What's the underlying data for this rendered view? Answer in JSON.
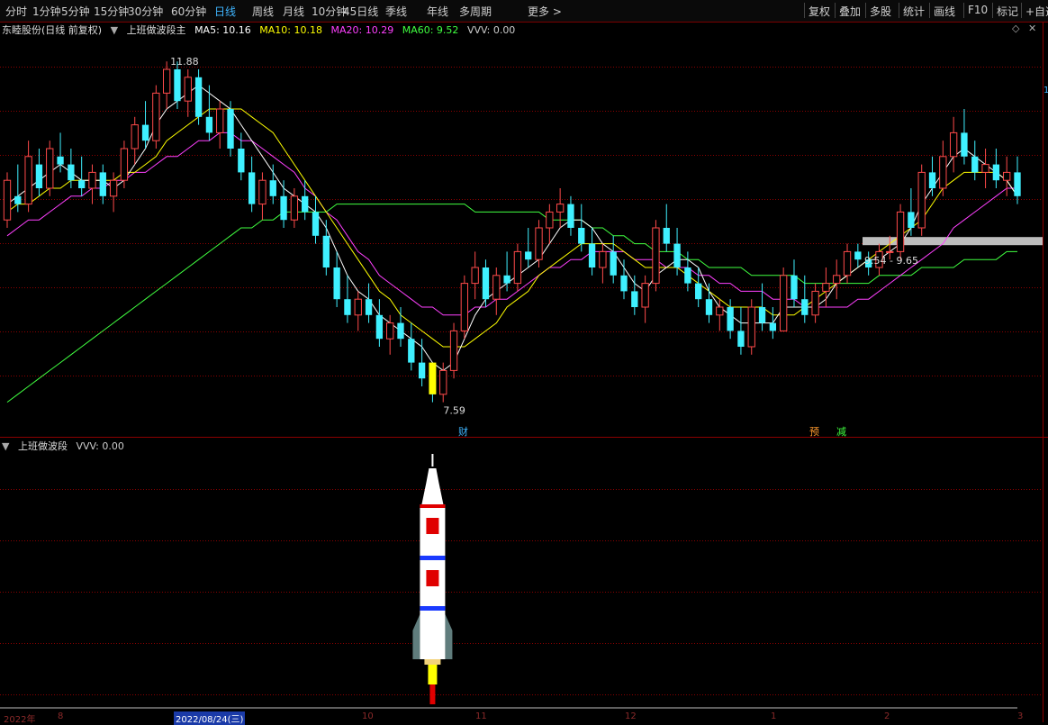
{
  "toolbar": {
    "periods": [
      "分时",
      "1分钟",
      "5分钟",
      "15分钟",
      "30分钟",
      "60分钟",
      "日线",
      "周线",
      "月线",
      "10分钟",
      "45日线",
      "季线",
      "年线",
      "多周期",
      "更多 >"
    ],
    "active_period": "日线",
    "tools": [
      "复权",
      "叠加",
      "多股",
      "统计",
      "画线",
      "F10",
      "标记",
      "+自选"
    ]
  },
  "main_legend": {
    "stock": "东睦股份(日线 前复权)",
    "indicator": "上班做波段主",
    "ma5": "MA5: 10.16",
    "ma10": "MA10: 10.18",
    "ma20": "MA20: 10.29",
    "ma60": "MA60: 9.52",
    "vvv": "VVV: 0.00"
  },
  "sub_legend": {
    "indicator": "上班做波段",
    "vvv": "VVV: 0.00"
  },
  "colors": {
    "up": "#ff4a4a",
    "down": "#3ff0ff",
    "ma5": "#ffffff",
    "ma10": "#ffff00",
    "ma20": "#ff40ff",
    "ma60": "#40ff40",
    "grid": "#8b0000"
  },
  "annotations": {
    "high_label": "11.88",
    "low_label": "7.59",
    "range_label": "9.54 - 9.65",
    "right_edge_label": "1",
    "marker_cai": "财",
    "marker_yu": "预",
    "marker_jian": "减"
  },
  "date_axis": {
    "labels": [
      "2022年",
      "8",
      "2022/08/24(三)",
      "10",
      "11",
      "12",
      "1",
      "2",
      "3"
    ],
    "highlighted": "2022/08/24(三)"
  },
  "chart_data": {
    "type": "candlestick",
    "title": "东睦股份(日线 前复权)",
    "ylim": [
      7.3,
      12.3
    ],
    "candles": [
      {
        "o": 9.9,
        "h": 10.5,
        "l": 9.8,
        "c": 10.4
      },
      {
        "o": 10.2,
        "h": 10.6,
        "l": 10.0,
        "c": 10.1
      },
      {
        "o": 10.1,
        "h": 10.9,
        "l": 10.0,
        "c": 10.7
      },
      {
        "o": 10.6,
        "h": 10.8,
        "l": 10.2,
        "c": 10.3
      },
      {
        "o": 10.3,
        "h": 10.9,
        "l": 10.2,
        "c": 10.8
      },
      {
        "o": 10.7,
        "h": 11.0,
        "l": 10.5,
        "c": 10.6
      },
      {
        "o": 10.6,
        "h": 10.8,
        "l": 10.3,
        "c": 10.4
      },
      {
        "o": 10.4,
        "h": 10.7,
        "l": 10.2,
        "c": 10.3
      },
      {
        "o": 10.3,
        "h": 10.6,
        "l": 10.1,
        "c": 10.5
      },
      {
        "o": 10.5,
        "h": 10.6,
        "l": 10.1,
        "c": 10.2
      },
      {
        "o": 10.2,
        "h": 10.5,
        "l": 10.0,
        "c": 10.4
      },
      {
        "o": 10.4,
        "h": 10.9,
        "l": 10.3,
        "c": 10.8
      },
      {
        "o": 10.8,
        "h": 11.2,
        "l": 10.6,
        "c": 11.1
      },
      {
        "o": 11.1,
        "h": 11.4,
        "l": 10.8,
        "c": 10.9
      },
      {
        "o": 10.9,
        "h": 11.6,
        "l": 10.8,
        "c": 11.5
      },
      {
        "o": 11.5,
        "h": 11.9,
        "l": 11.3,
        "c": 11.8
      },
      {
        "o": 11.8,
        "h": 11.9,
        "l": 11.3,
        "c": 11.4
      },
      {
        "o": 11.4,
        "h": 11.8,
        "l": 11.2,
        "c": 11.7
      },
      {
        "o": 11.7,
        "h": 11.8,
        "l": 11.1,
        "c": 11.2
      },
      {
        "o": 11.2,
        "h": 11.6,
        "l": 10.9,
        "c": 11.0
      },
      {
        "o": 11.0,
        "h": 11.4,
        "l": 10.8,
        "c": 11.3
      },
      {
        "o": 11.3,
        "h": 11.4,
        "l": 10.7,
        "c": 10.8
      },
      {
        "o": 10.8,
        "h": 11.0,
        "l": 10.4,
        "c": 10.5
      },
      {
        "o": 10.5,
        "h": 10.7,
        "l": 10.0,
        "c": 10.1
      },
      {
        "o": 10.1,
        "h": 10.5,
        "l": 9.9,
        "c": 10.4
      },
      {
        "o": 10.4,
        "h": 10.6,
        "l": 10.1,
        "c": 10.2
      },
      {
        "o": 10.2,
        "h": 10.4,
        "l": 9.8,
        "c": 9.9
      },
      {
        "o": 9.9,
        "h": 10.3,
        "l": 9.8,
        "c": 10.2
      },
      {
        "o": 10.2,
        "h": 10.4,
        "l": 9.9,
        "c": 10.0
      },
      {
        "o": 10.0,
        "h": 10.2,
        "l": 9.6,
        "c": 9.7
      },
      {
        "o": 9.7,
        "h": 9.9,
        "l": 9.2,
        "c": 9.3
      },
      {
        "o": 9.3,
        "h": 9.5,
        "l": 8.8,
        "c": 8.9
      },
      {
        "o": 8.9,
        "h": 9.2,
        "l": 8.6,
        "c": 8.7
      },
      {
        "o": 8.7,
        "h": 9.0,
        "l": 8.5,
        "c": 8.9
      },
      {
        "o": 8.9,
        "h": 9.1,
        "l": 8.6,
        "c": 8.7
      },
      {
        "o": 8.7,
        "h": 8.9,
        "l": 8.3,
        "c": 8.4
      },
      {
        "o": 8.4,
        "h": 8.7,
        "l": 8.2,
        "c": 8.6
      },
      {
        "o": 8.6,
        "h": 8.8,
        "l": 8.3,
        "c": 8.4
      },
      {
        "o": 8.4,
        "h": 8.6,
        "l": 8.0,
        "c": 8.1
      },
      {
        "o": 8.1,
        "h": 8.4,
        "l": 7.8,
        "c": 7.9
      },
      {
        "o": 7.9,
        "h": 8.1,
        "l": 7.6,
        "c": 7.7
      },
      {
        "o": 7.7,
        "h": 8.1,
        "l": 7.6,
        "c": 8.0
      },
      {
        "o": 8.0,
        "h": 8.6,
        "l": 7.9,
        "c": 8.5
      },
      {
        "o": 8.5,
        "h": 9.2,
        "l": 8.4,
        "c": 9.1
      },
      {
        "o": 9.1,
        "h": 9.5,
        "l": 8.9,
        "c": 9.3
      },
      {
        "o": 9.3,
        "h": 9.4,
        "l": 8.8,
        "c": 8.9
      },
      {
        "o": 8.9,
        "h": 9.3,
        "l": 8.7,
        "c": 9.2
      },
      {
        "o": 9.2,
        "h": 9.5,
        "l": 9.0,
        "c": 9.1
      },
      {
        "o": 9.1,
        "h": 9.6,
        "l": 9.0,
        "c": 9.5
      },
      {
        "o": 9.5,
        "h": 9.8,
        "l": 9.3,
        "c": 9.4
      },
      {
        "o": 9.4,
        "h": 9.9,
        "l": 9.3,
        "c": 9.8
      },
      {
        "o": 9.8,
        "h": 10.1,
        "l": 9.6,
        "c": 10.0
      },
      {
        "o": 10.0,
        "h": 10.3,
        "l": 9.8,
        "c": 10.1
      },
      {
        "o": 10.1,
        "h": 10.2,
        "l": 9.7,
        "c": 9.8
      },
      {
        "o": 9.8,
        "h": 10.1,
        "l": 9.5,
        "c": 9.6
      },
      {
        "o": 9.6,
        "h": 9.8,
        "l": 9.2,
        "c": 9.3
      },
      {
        "o": 9.3,
        "h": 9.6,
        "l": 9.1,
        "c": 9.5
      },
      {
        "o": 9.5,
        "h": 9.7,
        "l": 9.1,
        "c": 9.2
      },
      {
        "o": 9.2,
        "h": 9.4,
        "l": 8.9,
        "c": 9.0
      },
      {
        "o": 9.0,
        "h": 9.2,
        "l": 8.7,
        "c": 8.8
      },
      {
        "o": 8.8,
        "h": 9.2,
        "l": 8.6,
        "c": 9.1
      },
      {
        "o": 9.1,
        "h": 9.9,
        "l": 9.0,
        "c": 9.8
      },
      {
        "o": 9.8,
        "h": 10.1,
        "l": 9.5,
        "c": 9.6
      },
      {
        "o": 9.6,
        "h": 9.8,
        "l": 9.2,
        "c": 9.3
      },
      {
        "o": 9.3,
        "h": 9.5,
        "l": 9.0,
        "c": 9.1
      },
      {
        "o": 9.1,
        "h": 9.3,
        "l": 8.8,
        "c": 8.9
      },
      {
        "o": 8.9,
        "h": 9.1,
        "l": 8.6,
        "c": 8.7
      },
      {
        "o": 8.7,
        "h": 8.9,
        "l": 8.5,
        "c": 8.8
      },
      {
        "o": 8.8,
        "h": 8.9,
        "l": 8.4,
        "c": 8.5
      },
      {
        "o": 8.5,
        "h": 8.8,
        "l": 8.2,
        "c": 8.3
      },
      {
        "o": 8.3,
        "h": 8.9,
        "l": 8.2,
        "c": 8.8
      },
      {
        "o": 8.8,
        "h": 9.1,
        "l": 8.5,
        "c": 8.6
      },
      {
        "o": 8.6,
        "h": 8.8,
        "l": 8.4,
        "c": 8.5
      },
      {
        "o": 8.5,
        "h": 9.3,
        "l": 8.5,
        "c": 9.2
      },
      {
        "o": 9.2,
        "h": 9.4,
        "l": 8.8,
        "c": 8.9
      },
      {
        "o": 8.9,
        "h": 9.2,
        "l": 8.6,
        "c": 8.7
      },
      {
        "o": 8.7,
        "h": 9.1,
        "l": 8.6,
        "c": 9.0
      },
      {
        "o": 9.0,
        "h": 9.3,
        "l": 8.8,
        "c": 9.1
      },
      {
        "o": 9.1,
        "h": 9.4,
        "l": 8.9,
        "c": 9.2
      },
      {
        "o": 9.2,
        "h": 9.6,
        "l": 9.1,
        "c": 9.5
      },
      {
        "o": 9.5,
        "h": 9.6,
        "l": 9.3,
        "c": 9.4
      },
      {
        "o": 9.4,
        "h": 9.5,
        "l": 9.2,
        "c": 9.3
      },
      {
        "o": 9.3,
        "h": 9.6,
        "l": 9.2,
        "c": 9.5
      },
      {
        "o": 9.5,
        "h": 9.7,
        "l": 9.4,
        "c": 9.5
      },
      {
        "o": 9.5,
        "h": 10.1,
        "l": 9.4,
        "c": 10.0
      },
      {
        "o": 10.0,
        "h": 10.3,
        "l": 9.7,
        "c": 9.8
      },
      {
        "o": 9.8,
        "h": 10.6,
        "l": 9.7,
        "c": 10.5
      },
      {
        "o": 10.5,
        "h": 10.7,
        "l": 10.2,
        "c": 10.3
      },
      {
        "o": 10.3,
        "h": 10.9,
        "l": 10.2,
        "c": 10.7
      },
      {
        "o": 10.7,
        "h": 11.2,
        "l": 10.5,
        "c": 11.0
      },
      {
        "o": 11.0,
        "h": 11.3,
        "l": 10.6,
        "c": 10.7
      },
      {
        "o": 10.7,
        "h": 10.9,
        "l": 10.4,
        "c": 10.5
      },
      {
        "o": 10.5,
        "h": 10.8,
        "l": 10.3,
        "c": 10.6
      },
      {
        "o": 10.6,
        "h": 10.8,
        "l": 10.3,
        "c": 10.4
      },
      {
        "o": 10.4,
        "h": 10.7,
        "l": 10.2,
        "c": 10.5
      },
      {
        "o": 10.5,
        "h": 10.7,
        "l": 10.1,
        "c": 10.2
      }
    ],
    "ma5": [
      10.1,
      10.2,
      10.3,
      10.4,
      10.5,
      10.6,
      10.5,
      10.4,
      10.4,
      10.4,
      10.3,
      10.4,
      10.6,
      10.8,
      11.1,
      11.3,
      11.4,
      11.5,
      11.6,
      11.5,
      11.4,
      11.3,
      11.1,
      10.9,
      10.7,
      10.5,
      10.3,
      10.2,
      10.1,
      10.0,
      9.8,
      9.5,
      9.2,
      9.0,
      8.9,
      8.7,
      8.6,
      8.5,
      8.4,
      8.3,
      8.1,
      8.0,
      8.1,
      8.4,
      8.7,
      8.9,
      9.0,
      9.1,
      9.2,
      9.3,
      9.4,
      9.6,
      9.8,
      9.9,
      9.9,
      9.8,
      9.6,
      9.5,
      9.3,
      9.1,
      9.0,
      9.2,
      9.3,
      9.4,
      9.4,
      9.3,
      9.0,
      8.8,
      8.7,
      8.6,
      8.6,
      8.6,
      8.6,
      8.8,
      8.8,
      8.8,
      8.8,
      8.9,
      9.1,
      9.2,
      9.3,
      9.4,
      9.4,
      9.5,
      9.6,
      9.8,
      10.1,
      10.3,
      10.5,
      10.7,
      10.8,
      10.7,
      10.6,
      10.5,
      10.4,
      10.2
    ],
    "ma10": [
      10.0,
      10.1,
      10.1,
      10.2,
      10.3,
      10.3,
      10.4,
      10.4,
      10.4,
      10.4,
      10.4,
      10.5,
      10.5,
      10.6,
      10.7,
      10.9,
      11.0,
      11.1,
      11.2,
      11.3,
      11.3,
      11.3,
      11.3,
      11.2,
      11.1,
      11.0,
      10.8,
      10.6,
      10.4,
      10.2,
      10.0,
      9.8,
      9.6,
      9.4,
      9.2,
      9.0,
      8.9,
      8.7,
      8.6,
      8.5,
      8.4,
      8.3,
      8.3,
      8.3,
      8.4,
      8.5,
      8.6,
      8.8,
      8.9,
      9.0,
      9.2,
      9.3,
      9.4,
      9.5,
      9.6,
      9.6,
      9.6,
      9.6,
      9.5,
      9.4,
      9.3,
      9.3,
      9.3,
      9.3,
      9.2,
      9.1,
      9.0,
      8.9,
      8.8,
      8.8,
      8.8,
      8.8,
      8.7,
      8.7,
      8.7,
      8.8,
      8.9,
      9.0,
      9.1,
      9.2,
      9.3,
      9.4,
      9.5,
      9.6,
      9.7,
      9.8,
      9.9,
      10.1,
      10.3,
      10.4,
      10.5,
      10.5,
      10.5,
      10.5,
      10.4,
      10.2
    ],
    "ma20": [
      9.7,
      9.8,
      9.9,
      9.9,
      10.0,
      10.1,
      10.2,
      10.2,
      10.3,
      10.3,
      10.4,
      10.4,
      10.5,
      10.5,
      10.6,
      10.7,
      10.7,
      10.8,
      10.9,
      10.9,
      11.0,
      11.0,
      10.9,
      10.9,
      10.8,
      10.7,
      10.6,
      10.5,
      10.3,
      10.2,
      10.0,
      9.9,
      9.7,
      9.5,
      9.4,
      9.2,
      9.1,
      9.0,
      8.9,
      8.8,
      8.8,
      8.7,
      8.7,
      8.7,
      8.8,
      8.8,
      8.9,
      8.9,
      9.0,
      9.1,
      9.2,
      9.3,
      9.3,
      9.4,
      9.4,
      9.5,
      9.5,
      9.5,
      9.5,
      9.4,
      9.4,
      9.4,
      9.3,
      9.3,
      9.3,
      9.2,
      9.2,
      9.1,
      9.1,
      9.0,
      9.0,
      9.0,
      8.9,
      8.9,
      8.9,
      8.8,
      8.8,
      8.8,
      8.8,
      8.8,
      8.9,
      8.9,
      9.0,
      9.1,
      9.2,
      9.3,
      9.4,
      9.5,
      9.6,
      9.8,
      9.9,
      10.0,
      10.1,
      10.2,
      10.3,
      10.3
    ],
    "ma60": [
      7.6,
      7.7,
      7.8,
      7.9,
      8.0,
      8.1,
      8.2,
      8.3,
      8.4,
      8.5,
      8.6,
      8.7,
      8.8,
      8.9,
      9.0,
      9.1,
      9.2,
      9.3,
      9.4,
      9.5,
      9.6,
      9.7,
      9.8,
      9.8,
      9.9,
      9.9,
      10.0,
      10.0,
      10.0,
      10.0,
      10.0,
      10.1,
      10.1,
      10.1,
      10.1,
      10.1,
      10.1,
      10.1,
      10.1,
      10.1,
      10.1,
      10.1,
      10.1,
      10.1,
      10.0,
      10.0,
      10.0,
      10.0,
      10.0,
      10.0,
      10.0,
      9.9,
      9.9,
      9.9,
      9.9,
      9.8,
      9.8,
      9.7,
      9.7,
      9.6,
      9.6,
      9.5,
      9.5,
      9.5,
      9.4,
      9.4,
      9.3,
      9.3,
      9.3,
      9.3,
      9.2,
      9.2,
      9.2,
      9.2,
      9.2,
      9.1,
      9.1,
      9.1,
      9.1,
      9.1,
      9.1,
      9.1,
      9.2,
      9.2,
      9.2,
      9.2,
      9.3,
      9.3,
      9.3,
      9.3,
      9.4,
      9.4,
      9.4,
      9.4,
      9.5,
      9.5
    ],
    "signal_bar": {
      "index": 40,
      "from": 7.7,
      "to": 8.1
    },
    "resistance_band": {
      "low": 9.54,
      "high": 9.65
    },
    "sub_signal": {
      "index": 40,
      "type": "rocket"
    }
  }
}
